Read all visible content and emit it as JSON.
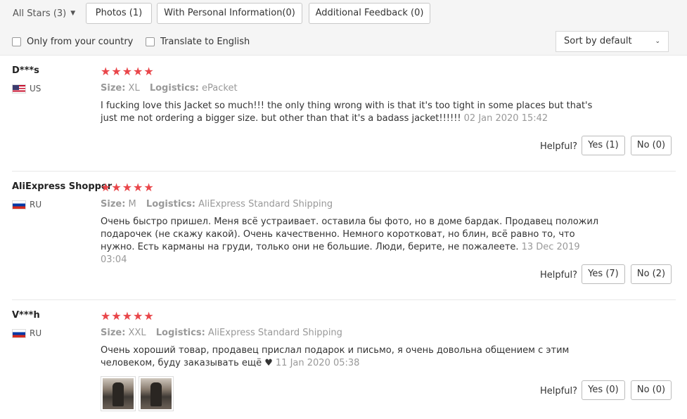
{
  "filters": {
    "all_stars": "All Stars (3)",
    "photos": "Photos (1)",
    "personal_info": "With Personal Information(0)",
    "additional_feedback": "Additional Feedback (0)"
  },
  "options": {
    "only_country": "Only from your country",
    "translate": "Translate to English",
    "sort": "Sort by default"
  },
  "labels": {
    "size": "Size:",
    "logistics": "Logistics:",
    "helpful": "Helpful?"
  },
  "reviews": [
    {
      "user": "D***s",
      "country": "US",
      "stars": "★★★★★",
      "size": "XL",
      "logistics": "ePacket",
      "text": "I fucking love this Jacket so much!!! the only thing wrong with is that it's too tight in some places but that's just me not ordering a bigger size. but other than that it's a badass jacket!!!!!!",
      "date": "02 Jan 2020 15:42",
      "yes": "Yes (1)",
      "no": "No (0)"
    },
    {
      "user": "AliExpress Shopper",
      "country": "RU",
      "stars": "★★★★★",
      "size": "M",
      "logistics": "AliExpress Standard Shipping",
      "text": "Очень быстро пришел. Меня всё устраивает. оставила бы фото, но в доме бардак. Продавец положил подарочек (не скажу какой). Очень качественно. Немного коротковат, но блин, всё равно то, что нужно. Есть карманы на груди, только они не большие. Люди, берите, не пожалеете.",
      "date": "13 Dec 2019 03:04",
      "yes": "Yes (7)",
      "no": "No (2)"
    },
    {
      "user": "V***h",
      "country": "RU",
      "stars": "★★★★★",
      "size": "XXL",
      "logistics": "AliExpress Standard Shipping",
      "text": "Очень хороший товар, продавец прислал подарок и письмо, я очень довольна общением с этим человеком, буду заказывать ещё ♥",
      "date": "11 Jan 2020 05:38",
      "yes": "Yes (0)",
      "no": "No (0)"
    }
  ],
  "colors": {
    "star": "#e9464a",
    "muted": "#999999",
    "bar_bg": "#f5f5f5"
  }
}
